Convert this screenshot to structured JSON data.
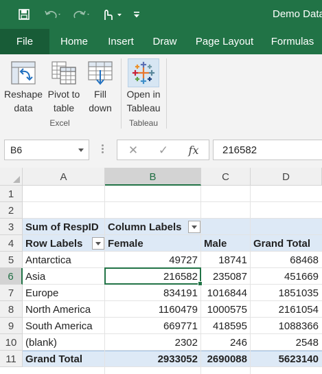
{
  "window": {
    "title": "Demo Data",
    "quick_access": [
      "save-icon",
      "undo-icon",
      "redo-icon",
      "touch-mode-icon",
      "customize-qat-icon"
    ]
  },
  "menu": {
    "items": [
      "File",
      "Home",
      "Insert",
      "Draw",
      "Page Layout",
      "Formulas"
    ],
    "active": "File"
  },
  "ribbon": {
    "groups": [
      {
        "label": "Excel",
        "buttons": [
          {
            "label_line1": "Reshape",
            "label_line2": "data",
            "icon": "reshape-data-icon"
          },
          {
            "label_line1": "Pivot to",
            "label_line2": "table",
            "icon": "pivot-to-table-icon"
          },
          {
            "label_line1": "Fill",
            "label_line2": "down",
            "icon": "fill-down-icon"
          }
        ]
      },
      {
        "label": "Tableau",
        "buttons": [
          {
            "label_line1": "Open in",
            "label_line2": "Tableau",
            "icon": "tableau-logo-icon"
          }
        ]
      }
    ]
  },
  "formula_bar": {
    "name_box": "B6",
    "cancel_symbol": "✕",
    "enter_symbol": "✓",
    "fx_label": "fx",
    "formula": "216582"
  },
  "sheet": {
    "columns": [
      "A",
      "B",
      "C",
      "D"
    ],
    "selected_column": "B",
    "selected_row": "6",
    "active_cell": "B6",
    "rows": [
      {
        "num": "1",
        "cells": [
          "",
          "",
          "",
          ""
        ]
      },
      {
        "num": "2",
        "cells": [
          "",
          "",
          "",
          ""
        ]
      },
      {
        "num": "3",
        "cells": [
          "Sum of RespID",
          "Column Labels",
          "",
          ""
        ]
      },
      {
        "num": "4",
        "cells": [
          "Row Labels",
          "Female",
          "Male",
          "Grand Total"
        ]
      },
      {
        "num": "5",
        "cells": [
          "Antarctica",
          "49727",
          "18741",
          "68468"
        ]
      },
      {
        "num": "6",
        "cells": [
          "Asia",
          "216582",
          "235087",
          "451669"
        ]
      },
      {
        "num": "7",
        "cells": [
          "Europe",
          "834191",
          "1016844",
          "1851035"
        ]
      },
      {
        "num": "8",
        "cells": [
          "North America",
          "1160479",
          "1000575",
          "2161054"
        ]
      },
      {
        "num": "9",
        "cells": [
          "South America",
          "669771",
          "418595",
          "1088366"
        ]
      },
      {
        "num": "10",
        "cells": [
          "(blank)",
          "2302",
          "246",
          "2548"
        ]
      },
      {
        "num": "11",
        "cells": [
          "Grand Total",
          "2933052",
          "2690088",
          "5623140"
        ]
      }
    ]
  },
  "colors": {
    "excel_green": "#217346",
    "pivot_header_band": "#dde9f6",
    "ribbon_bg": "#f3f3f3"
  }
}
